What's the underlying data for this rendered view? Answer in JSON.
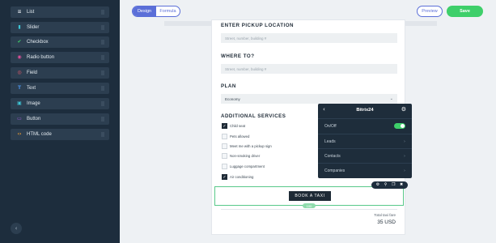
{
  "sidebar": {
    "items": [
      {
        "label": "List",
        "icon": "list-icon",
        "color": "#d9dfe6",
        "glyph": "≡"
      },
      {
        "label": "Slider",
        "icon": "slider-icon",
        "color": "#3ec6d6",
        "glyph": "▮"
      },
      {
        "label": "Checkbox",
        "icon": "checkbox-icon",
        "color": "#3ecf6a",
        "glyph": "✔"
      },
      {
        "label": "Radio button",
        "icon": "radio-icon",
        "color": "#e0509a",
        "glyph": "◉"
      },
      {
        "label": "Field",
        "icon": "field-icon",
        "color": "#e85a6a",
        "glyph": "◎"
      },
      {
        "label": "Text",
        "icon": "text-icon",
        "color": "#4a90e2",
        "glyph": "T"
      },
      {
        "label": "Image",
        "icon": "image-icon",
        "color": "#3ec6d6",
        "glyph": "▣"
      },
      {
        "label": "Button",
        "icon": "button-icon",
        "color": "#a05ad8",
        "glyph": "▭"
      },
      {
        "label": "HTML code",
        "icon": "code-icon",
        "color": "#f0a030",
        "glyph": "‹›"
      }
    ],
    "collapse_glyph": "‹"
  },
  "tabs": {
    "design": "Design",
    "formula": "Formula"
  },
  "header": {
    "preview": "Preview",
    "save": "Save"
  },
  "form": {
    "pickup_title": "ENTER PICKUP LOCATION",
    "pickup_placeholder": "Street, number, building #",
    "where_title": "WHERE TO?",
    "where_placeholder": "Street, number, building #",
    "plan_title": "PLAN",
    "plan_value": "Economy",
    "additional_title": "ADDITIONAL SERVICES",
    "services": [
      {
        "label": "Child seat",
        "checked": true
      },
      {
        "label": "Pets allowed",
        "checked": false
      },
      {
        "label": "Meet me with a pickup sign",
        "checked": false
      },
      {
        "label": "Non-smoking driver",
        "checked": false
      },
      {
        "label": "Luggage compartment",
        "checked": false
      },
      {
        "label": "Air conditioning",
        "checked": true
      }
    ],
    "book_button": "BOOK A TAXI",
    "size_tag": "100",
    "total_label": "Total taxi fare",
    "total_value": "35 USD"
  },
  "bitrix": {
    "title": "Bitrix24",
    "onoff_label": "On/Off",
    "onoff_state": true,
    "rows": [
      "Leads",
      "Contacts",
      "Companies"
    ]
  },
  "colors": {
    "accent": "#5b6fd8",
    "save": "#3ecf6a",
    "sidebar": "#1d2d3d"
  }
}
